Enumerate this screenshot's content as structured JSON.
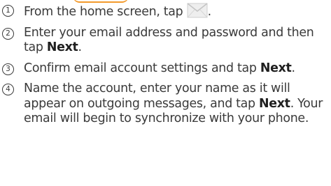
{
  "steps": [
    {
      "number": "1",
      "text_before": "From the home screen, tap ",
      "icon": "email-icon",
      "text_after": "."
    },
    {
      "number": "2",
      "text_before": "Enter your email address and password and then tap ",
      "bold": "Next",
      "text_after": "."
    },
    {
      "number": "3",
      "text_before": "Confirm email account settings and tap ",
      "bold": "Next",
      "text_after": "."
    },
    {
      "number": "4",
      "text_before": "Name the account, enter your name as it will appear on outgoing messages, and tap ",
      "bold": "Next",
      "text_after": ". Your email will begin to synchronize with your phone."
    }
  ],
  "colors": {
    "text": "#3a3a3a",
    "accent": "#f39a2b",
    "icon": "#cfcfcf"
  }
}
